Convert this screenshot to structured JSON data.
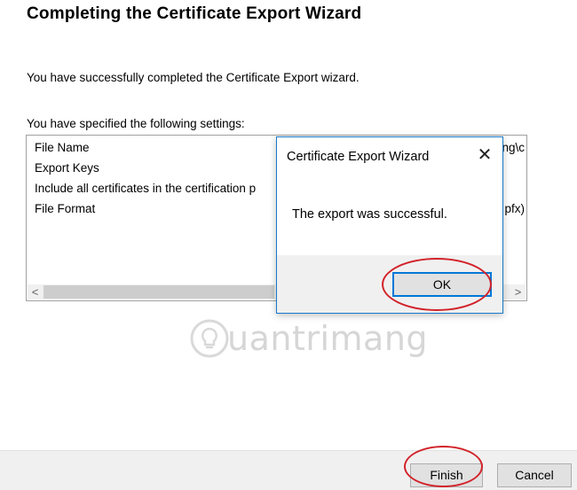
{
  "wizard": {
    "title": "Completing the Certificate Export Wizard",
    "success_text": "You have successfully completed the Certificate Export wizard.",
    "settings_label": "You have specified the following settings:",
    "settings": [
      {
        "name": "File Name",
        "value_clip": "ng\\c"
      },
      {
        "name": "Export Keys",
        "value_clip": ""
      },
      {
        "name": "Include all certificates in the certification p",
        "value_clip": ""
      },
      {
        "name": "File Format",
        "value_clip": "pfx)"
      }
    ],
    "scroll_left": "<",
    "scroll_right": ">",
    "finish_label": "Finish",
    "cancel_label": "Cancel"
  },
  "dialog": {
    "title": "Certificate Export Wizard",
    "message": "The export was successful.",
    "ok_label": "OK",
    "close_glyph": "✕"
  },
  "watermark": {
    "text": "uantrimang",
    "icon": "lightbulb-icon"
  },
  "colors": {
    "highlight_ellipse": "#d2232a",
    "dialog_border": "#1979ca",
    "default_button_border": "#0078d7"
  }
}
